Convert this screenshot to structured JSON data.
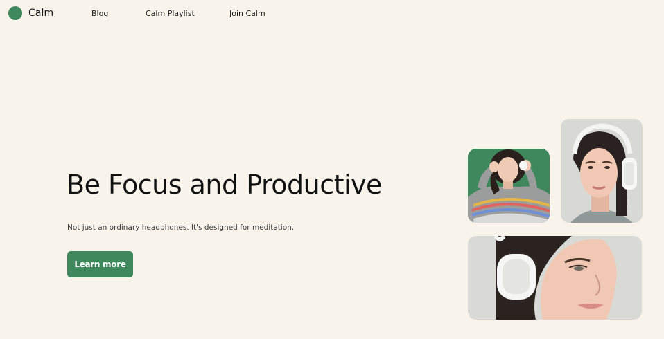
{
  "brand": {
    "name": "Calm",
    "accent_color": "#3f875c",
    "background_color": "#f8f4ec"
  },
  "nav": {
    "items": [
      {
        "label": "Blog"
      },
      {
        "label": "Calm Playlist"
      },
      {
        "label": "Join Calm"
      }
    ]
  },
  "hero": {
    "title": "Be Focus and Productive",
    "subtitle": "Not just an ordinary headphones. It's designed for meditation.",
    "cta_label": "Learn more"
  },
  "gallery": {
    "images": [
      {
        "icon": "woman-headphones-sweater-photo"
      },
      {
        "icon": "woman-headphones-portrait-photo"
      },
      {
        "icon": "woman-headphones-closeup-photo"
      }
    ]
  }
}
